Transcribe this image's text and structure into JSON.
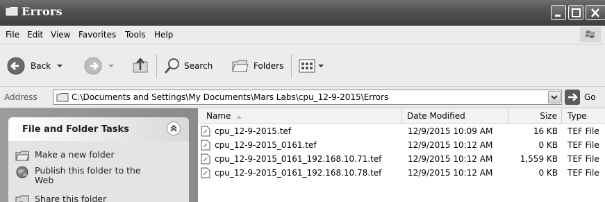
{
  "window": {
    "title": "Errors"
  },
  "menu": [
    "File",
    "Edit",
    "View",
    "Favorites",
    "Tools",
    "Help"
  ],
  "toolbar": {
    "back_label": "Back",
    "search_label": "Search",
    "folders_label": "Folders"
  },
  "address": {
    "label": "Address",
    "path": "C:\\Documents and Settings\\My Documents\\Mars Labs\\cpu_12-9-2015\\Errors",
    "go_label": "Go"
  },
  "tasks": {
    "title": "File and Folder Tasks",
    "items": [
      "Make a new folder",
      "Publish this folder to the Web",
      "Share this folder"
    ]
  },
  "columns": {
    "name": "Name",
    "date": "Date Modified",
    "size": "Size",
    "type": "Type"
  },
  "files": [
    {
      "name": "cpu_12-9-2015.tef",
      "date": "12/9/2015 10:09 AM",
      "size": "16 KB",
      "type": "TEF File"
    },
    {
      "name": "cpu_12-9-2015_0161.tef",
      "date": "12/9/2015 10:12 AM",
      "size": "0 KB",
      "type": "TEF File"
    },
    {
      "name": "cpu_12-9-2015_0161_192.168.10.71.tef",
      "date": "12/9/2015 10:12 AM",
      "size": "1,559 KB",
      "type": "TEF File"
    },
    {
      "name": "cpu_12-9-2015_0161_192.168.10.78.tef",
      "date": "12/9/2015 10:12 AM",
      "size": "0 KB",
      "type": "TEF File"
    }
  ]
}
